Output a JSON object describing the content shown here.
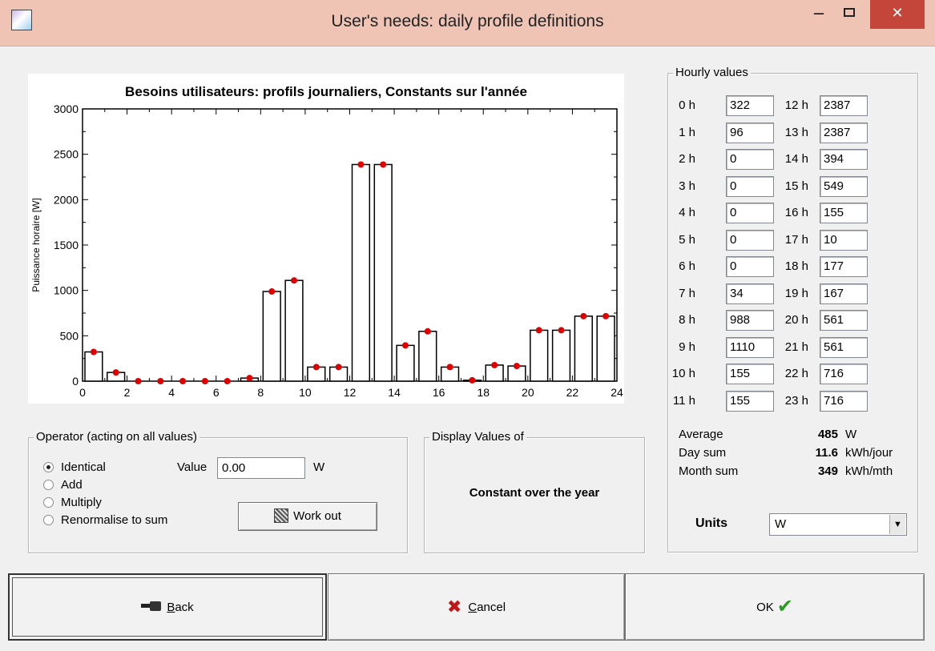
{
  "window": {
    "title": "User's needs: daily profile definitions",
    "minimize_glyph": "–",
    "close_glyph": "✕"
  },
  "chart_data": {
    "type": "bar",
    "title": "Besoins utilisateurs: profils journaliers, Constants sur l'année",
    "ylabel": "Puissance horaire [W]",
    "xlabel": "",
    "xlim": [
      0,
      24
    ],
    "ylim": [
      0,
      3000
    ],
    "x_ticks": [
      "0",
      "2",
      "4",
      "6",
      "8",
      "10",
      "12",
      "14",
      "16",
      "18",
      "20",
      "22",
      "24"
    ],
    "y_ticks": [
      "0",
      "500",
      "1000",
      "1500",
      "2000",
      "2500",
      "3000"
    ],
    "categories": [
      0,
      1,
      2,
      3,
      4,
      5,
      6,
      7,
      8,
      9,
      10,
      11,
      12,
      13,
      14,
      15,
      16,
      17,
      18,
      19,
      20,
      21,
      22,
      23
    ],
    "values": [
      322,
      96,
      0,
      0,
      0,
      0,
      0,
      34,
      988,
      1110,
      155,
      155,
      2387,
      2387,
      394,
      549,
      155,
      10,
      177,
      167,
      561,
      561,
      716,
      716
    ],
    "marker_color": "#e00000",
    "bar_fill": "#ffffff",
    "bar_stroke": "#000000"
  },
  "hourly": {
    "group_label": "Hourly values",
    "hours": [
      {
        "label": "0 h",
        "value": "322"
      },
      {
        "label": "1 h",
        "value": "96"
      },
      {
        "label": "2 h",
        "value": "0"
      },
      {
        "label": "3 h",
        "value": "0"
      },
      {
        "label": "4 h",
        "value": "0"
      },
      {
        "label": "5 h",
        "value": "0"
      },
      {
        "label": "6 h",
        "value": "0"
      },
      {
        "label": "7 h",
        "value": "34"
      },
      {
        "label": "8 h",
        "value": "988"
      },
      {
        "label": "9 h",
        "value": "1110"
      },
      {
        "label": "10 h",
        "value": "155"
      },
      {
        "label": "11 h",
        "value": "155"
      },
      {
        "label": "12 h",
        "value": "2387"
      },
      {
        "label": "13 h",
        "value": "2387"
      },
      {
        "label": "14 h",
        "value": "394"
      },
      {
        "label": "15 h",
        "value": "549"
      },
      {
        "label": "16 h",
        "value": "155"
      },
      {
        "label": "17 h",
        "value": "10"
      },
      {
        "label": "18 h",
        "value": "177"
      },
      {
        "label": "19 h",
        "value": "167"
      },
      {
        "label": "20 h",
        "value": "561"
      },
      {
        "label": "21 h",
        "value": "561"
      },
      {
        "label": "22 h",
        "value": "716"
      },
      {
        "label": "23 h",
        "value": "716"
      }
    ],
    "stats": [
      {
        "label": "Average",
        "value": "485",
        "unit": "W"
      },
      {
        "label": "Day sum",
        "value": "11.6",
        "unit": "kWh/jour"
      },
      {
        "label": "Month sum",
        "value": "349",
        "unit": "kWh/mth"
      }
    ],
    "units_label": "Units",
    "units_value": "W"
  },
  "operator": {
    "group_label": "Operator  (acting on all values)",
    "options": [
      "Identical",
      "Add",
      "Multiply",
      "Renormalise to sum"
    ],
    "selected_index": 0,
    "value_label": "Value",
    "value": "0.00",
    "value_unit": "W",
    "work_out_label": "Work out"
  },
  "display": {
    "group_label": "Display Values of",
    "text": "Constant over the year"
  },
  "buttons": {
    "back_accel": "B",
    "back_rest": "ack",
    "cancel_accel": "C",
    "cancel_rest": "ancel",
    "ok": "OK"
  }
}
